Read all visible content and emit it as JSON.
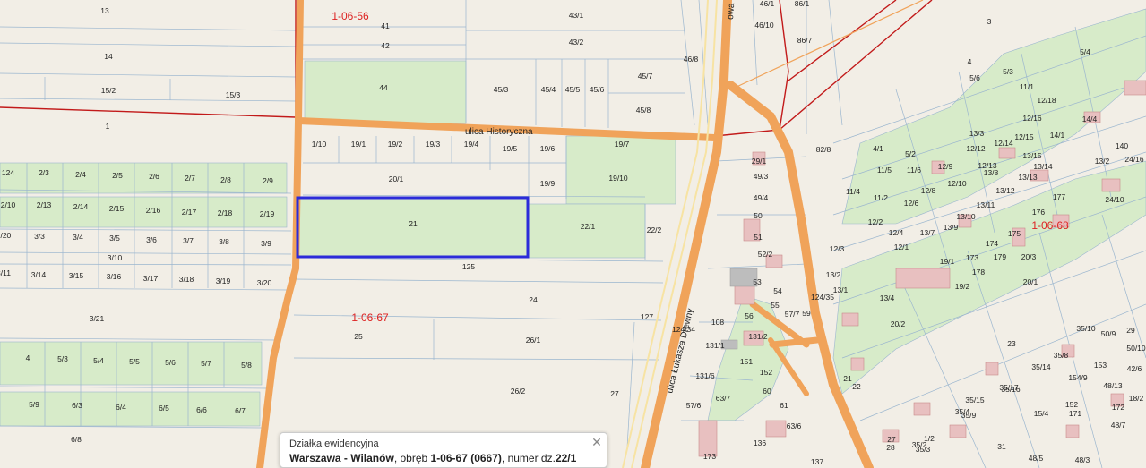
{
  "map": {
    "precincts": [
      "1-06-56",
      "1-06-67",
      "1-06-68"
    ],
    "streets": [
      "ulica Historyczna",
      "ulica Łukasza Drewny",
      "owa"
    ],
    "parcels": [
      "13",
      "14",
      "15/2",
      "15/3",
      "1",
      "41",
      "42",
      "43/1",
      "43/2",
      "44",
      "45/3",
      "45/4",
      "45/5",
      "45/6",
      "45/7",
      "45/8",
      "46/8",
      "46/1",
      "46/10",
      "86/7",
      "86/1",
      "3",
      "4",
      "5/4",
      "5/3",
      "5/6",
      "11/1",
      "12/18",
      "12/16",
      "14/4",
      "14/1",
      "140",
      "13/3",
      "13/15",
      "13/14",
      "13/8",
      "13/2",
      "12/14",
      "12/15",
      "12/12",
      "12/9",
      "12/10",
      "12/8",
      "12/6",
      "12/13",
      "13/12",
      "13/11",
      "13/13",
      "13/9",
      "13/10",
      "13/7",
      "177",
      "24/10",
      "24/16",
      "1/10",
      "19/1",
      "19/2",
      "19/3",
      "19/4",
      "19/5",
      "19/6",
      "19/7",
      "20/1",
      "19/9",
      "19/10",
      "21",
      "22/1",
      "22/2",
      "125",
      "24",
      "25",
      "26/1",
      "26/2",
      "27",
      "127",
      "124/34",
      "124/35",
      "124",
      "2/3",
      "2/4",
      "2/5",
      "2/6",
      "2/7",
      "2/8",
      "2/9",
      "2/10",
      "2/13",
      "2/14",
      "2/15",
      "2/16",
      "2/17",
      "2/18",
      "2/19",
      "2/20",
      "3/3",
      "3/4",
      "3/5",
      "3/6",
      "3/7",
      "3/8",
      "3/9",
      "3/10",
      "3/11",
      "3/14",
      "3/15",
      "3/16",
      "3/17",
      "3/18",
      "3/19",
      "3/20",
      "3/21",
      "4",
      "5/3",
      "5/4",
      "5/5",
      "5/6",
      "5/7",
      "5/8",
      "5/9",
      "6/3",
      "6/4",
      "6/5",
      "6/6",
      "6/7",
      "6/8",
      "7",
      "29/1",
      "49/3",
      "49/4",
      "50",
      "51",
      "52/2",
      "53",
      "54",
      "55",
      "56",
      "57/7",
      "59",
      "108",
      "131/1",
      "131/2",
      "151",
      "152",
      "60",
      "61",
      "63/6",
      "63/7",
      "57/6",
      "131/6",
      "173",
      "136",
      "137",
      "82/8",
      "4/1",
      "5/2",
      "11/5",
      "11/6",
      "11/4",
      "11/2",
      "12/2",
      "12/4",
      "12/3",
      "12/1",
      "13/2",
      "13/1",
      "13/4",
      "19/1",
      "19/2",
      "173",
      "174",
      "175",
      "176",
      "178",
      "179",
      "20/3",
      "20/2",
      "20/1",
      "23",
      "29",
      "35/10",
      "35/8",
      "35/14",
      "35/17",
      "35/15",
      "35/16",
      "35/9",
      "35/4",
      "35/2",
      "35/3",
      "1/2",
      "21",
      "22",
      "27",
      "28",
      "31",
      "15/4",
      "154/9",
      "153",
      "152",
      "171",
      "172",
      "48/7",
      "48/5",
      "48/3",
      "48/13",
      "50/9",
      "50/10",
      "42/6",
      "18/2",
      "18/9",
      "18/19",
      "22/2",
      "22/3"
    ],
    "highlighted_parcel": "22/1"
  },
  "colors": {
    "background": "#f2eee6",
    "parcel_line": "#9bb6cf",
    "green": "#d7ebc9",
    "road": "#f0a35a",
    "boundary": "#c21a1a",
    "highlight": "#2b2bd9",
    "building": "#e8c0c0"
  },
  "infobox": {
    "title": "Działka ewidencyjna",
    "place": "Warszawa - Wilanów",
    "obreb_prefix": ", obręb ",
    "obreb": "1-06-67 (0667)",
    "numer_prefix": ", numer dz.",
    "numer": "22/1",
    "close_icon": "close-x-icon"
  }
}
